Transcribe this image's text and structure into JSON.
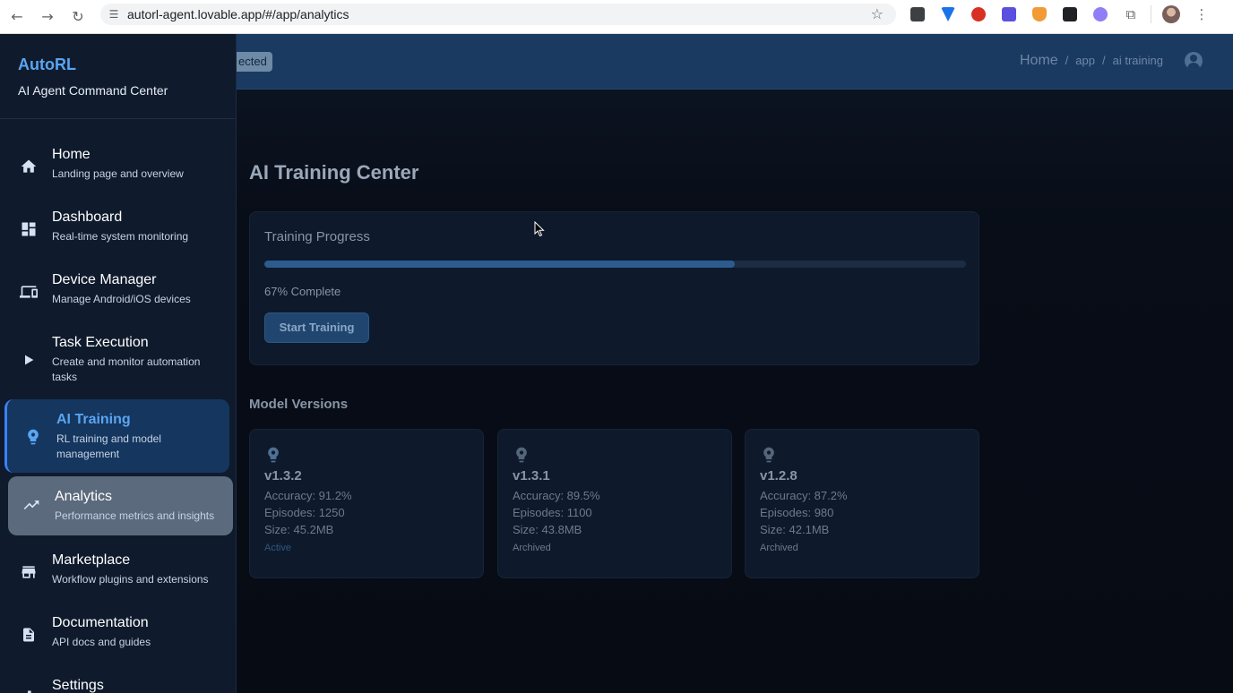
{
  "browser": {
    "url": "autorl-agent.lovable.app/#/app/analytics"
  },
  "sidebar": {
    "brand": "AutoRL",
    "tagline": "AI Agent Command Center",
    "items": [
      {
        "label": "Home",
        "desc": "Landing page and overview",
        "icon": "home-icon"
      },
      {
        "label": "Dashboard",
        "desc": "Real-time system monitoring",
        "icon": "dashboard-icon"
      },
      {
        "label": "Device Manager",
        "desc": "Manage Android/iOS devices",
        "icon": "devices-icon"
      },
      {
        "label": "Task Execution",
        "desc": "Create and monitor automation tasks",
        "icon": "play-icon"
      },
      {
        "label": "AI Training",
        "desc": "RL training and model management",
        "icon": "brain-icon"
      },
      {
        "label": "Analytics",
        "desc": "Performance metrics and insights",
        "icon": "trending-up-icon"
      },
      {
        "label": "Marketplace",
        "desc": "Workflow plugins and extensions",
        "icon": "store-icon"
      },
      {
        "label": "Documentation",
        "desc": "API docs and guides",
        "icon": "document-icon"
      },
      {
        "label": "Settings",
        "desc": "",
        "icon": "gear-icon"
      }
    ]
  },
  "header": {
    "status_badge": "ected",
    "breadcrumb": [
      "Home",
      "app",
      "ai training"
    ],
    "breadcrumb_sep": "/"
  },
  "main": {
    "title": "AI Training Center",
    "progress": {
      "title": "Training Progress",
      "percent": 67,
      "text": "67% Complete",
      "button": "Start Training"
    },
    "models_title": "Model Versions",
    "models": [
      {
        "version": "v1.3.2",
        "accuracy": "Accuracy: 91.2%",
        "episodes": "Episodes: 1250",
        "size": "Size: 45.2MB",
        "status": "Active"
      },
      {
        "version": "v1.3.1",
        "accuracy": "Accuracy: 89.5%",
        "episodes": "Episodes: 1100",
        "size": "Size: 43.8MB",
        "status": "Archived"
      },
      {
        "version": "v1.2.8",
        "accuracy": "Accuracy: 87.2%",
        "episodes": "Episodes: 980",
        "size": "Size: 42.1MB",
        "status": "Archived"
      }
    ]
  },
  "colors": {
    "accent": "#5aa5f0",
    "active_bg": "#14365f",
    "topbar": "#1a3a62",
    "progress_fill": "#2c5b8f"
  }
}
